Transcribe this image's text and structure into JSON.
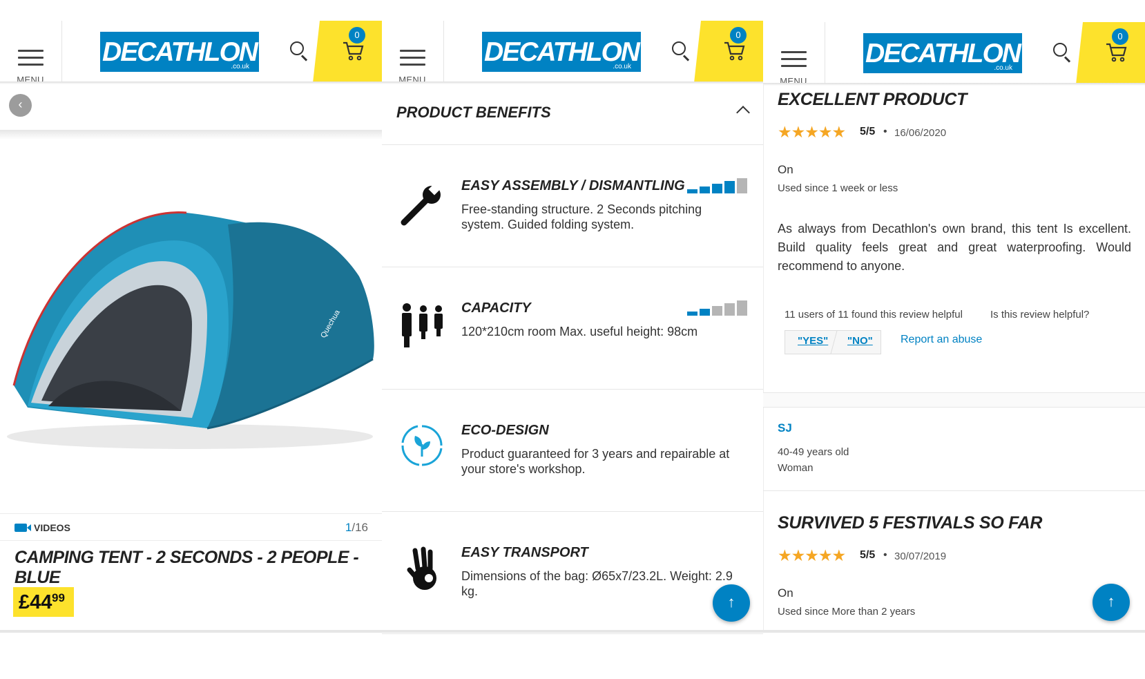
{
  "header": {
    "menu_label": "MENU",
    "logo_text": "DECATHLON",
    "logo_tld": ".co.uk",
    "cart_count": "0",
    "colors": {
      "brand_blue": "#0082c3",
      "yellow": "#fde22c"
    }
  },
  "product": {
    "videos_label": "VIDEOS",
    "counter_current": "1",
    "counter_total": "/16",
    "title": "CAMPING TENT - 2 SECONDS - 2 PEOPLE - BLUE",
    "price_main": "£44",
    "price_cents": "99"
  },
  "benefits": {
    "heading": "PRODUCT BENEFITS",
    "items": [
      {
        "icon": "wrench-icon",
        "title": "EASY ASSEMBLY / DISMANTLING",
        "body": "Free-standing structure. 2 Seconds pitching system. Guided folding system.",
        "level": 4,
        "max": 5
      },
      {
        "icon": "people-icon",
        "title": "CAPACITY",
        "body": "120*210cm room Max. useful height: 98cm",
        "level": 2,
        "max": 5
      },
      {
        "icon": "eco-icon",
        "title": "ECO-DESIGN",
        "body": "Product guaranteed for 3 years and repairable at your store's workshop.",
        "level": 0,
        "max": 0
      },
      {
        "icon": "ok-hand-icon",
        "title": "EASY TRANSPORT",
        "body": "Dimensions of the bag: Ø65x7/23.2L. Weight: 2.9 kg.",
        "level": 0,
        "max": 0
      }
    ]
  },
  "reviews": {
    "review1": {
      "title": "EXCELLENT PRODUCT",
      "rating": "5/5",
      "stars": 5,
      "dot": "•",
      "date": "16/06/2020",
      "on": "On",
      "used_since": "Used since 1 week or less",
      "body": "As always from Decathlon's own brand, this tent Is excellent. Build quality feels great and great waterproofing. Would recommend to anyone.",
      "helpful_count": "11 users of 11 found this review helpful",
      "ask": "Is this review helpful?",
      "yes": "\"YES\"",
      "no": "\"NO\"",
      "report": "Report an abuse"
    },
    "author2": {
      "name": "SJ",
      "age": "40-49 years old",
      "gender": "Woman"
    },
    "review2": {
      "title": "SURVIVED 5 FESTIVALS SO FAR",
      "rating": "5/5",
      "stars": 5,
      "dot": "•",
      "date": "30/07/2019",
      "on": "On",
      "used_since": "Used since More than 2 years"
    }
  }
}
